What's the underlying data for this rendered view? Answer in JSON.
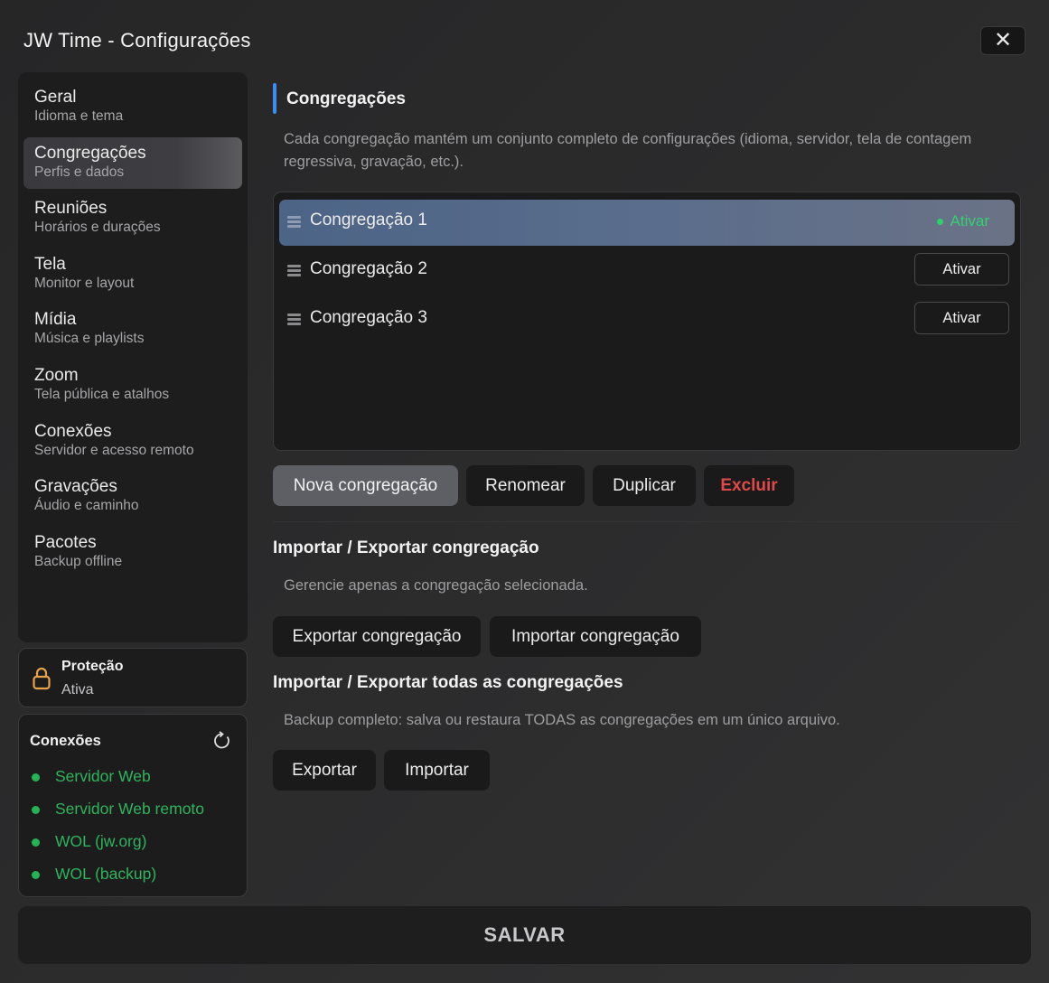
{
  "window": {
    "title": "JW Time - Configurações",
    "close_glyph": "✕"
  },
  "sidebar": {
    "items": [
      {
        "label": "Geral",
        "sub": "Idioma e tema"
      },
      {
        "label": "Congregações",
        "sub": "Perfis e dados",
        "active": true
      },
      {
        "label": "Reuniões",
        "sub": "Horários e durações"
      },
      {
        "label": "Tela",
        "sub": "Monitor e layout"
      },
      {
        "label": "Mídia",
        "sub": "Música e playlists"
      },
      {
        "label": "Zoom",
        "sub": "Tela pública e atalhos"
      },
      {
        "label": "Conexões",
        "sub": "Servidor e acesso remoto"
      },
      {
        "label": "Gravações",
        "sub": "Áudio e caminho"
      },
      {
        "label": "Pacotes",
        "sub": "Backup offline"
      }
    ]
  },
  "protection": {
    "title": "Proteção",
    "status": "Ativa",
    "icon": "lock-icon",
    "color": "#e8a24a"
  },
  "connections": {
    "title": "Conexões",
    "refresh_icon": "refresh-icon",
    "status_color": "#22b455",
    "items": [
      {
        "label": "Servidor Web"
      },
      {
        "label": "Servidor Web remoto"
      },
      {
        "label": "WOL (jw.org)"
      },
      {
        "label": "WOL (backup)"
      }
    ]
  },
  "main": {
    "section_title": "Congregações",
    "accent_color": "#3d8cf2",
    "description": "Cada congregação mantém um conjunto completo de configurações (idioma, servidor, tela de contagem regressiva, gravação, etc.).",
    "congregations": [
      {
        "name": "Congregação 1",
        "action": "Ativar",
        "selected": true,
        "active": true
      },
      {
        "name": "Congregação 2",
        "action": "Ativar"
      },
      {
        "name": "Congregação 3",
        "action": "Ativar"
      }
    ],
    "actions": {
      "new": "Nova congregação",
      "rename": "Renomear",
      "duplicate": "Duplicar",
      "delete": "Excluir"
    },
    "import_export_one": {
      "title": "Importar / Exportar congregação",
      "description": "Gerencie apenas a congregação selecionada.",
      "export": "Exportar congregação",
      "import": "Importar congregação"
    },
    "import_export_all": {
      "title": "Importar / Exportar todas as congregações",
      "description": "Backup completo: salva ou restaura TODAS as congregações em um único arquivo.",
      "export": "Exportar",
      "import": "Importar"
    }
  },
  "footer": {
    "save": "SALVAR"
  }
}
